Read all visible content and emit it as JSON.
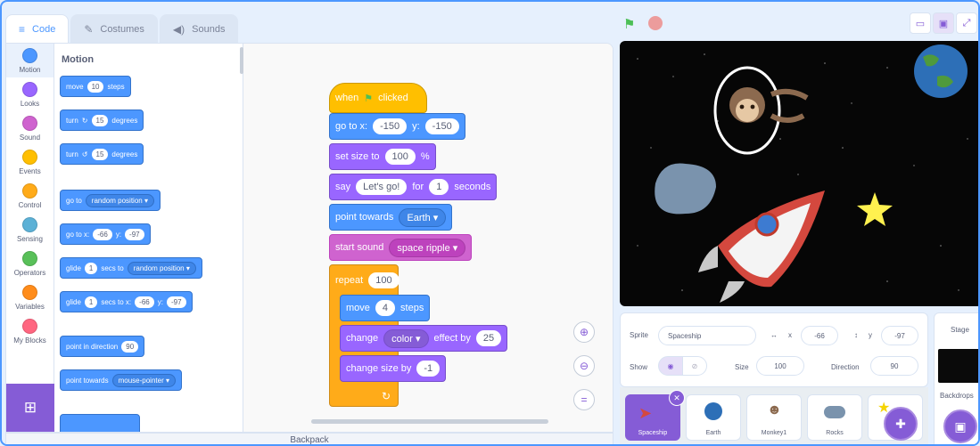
{
  "tabs": {
    "code": "Code",
    "costumes": "Costumes",
    "sounds": "Sounds"
  },
  "categories": [
    {
      "label": "Motion",
      "color": "#4c97ff"
    },
    {
      "label": "Looks",
      "color": "#9966ff"
    },
    {
      "label": "Sound",
      "color": "#cf63cf"
    },
    {
      "label": "Events",
      "color": "#ffbf00"
    },
    {
      "label": "Control",
      "color": "#ffab19"
    },
    {
      "label": "Sensing",
      "color": "#5cb1d6"
    },
    {
      "label": "Operators",
      "color": "#59c059"
    },
    {
      "label": "Variables",
      "color": "#ff8c1a"
    },
    {
      "label": "My Blocks",
      "color": "#ff6680"
    }
  ],
  "palette": {
    "title": "Motion",
    "move": {
      "a": "move",
      "v": "10",
      "b": "steps"
    },
    "turn_right": {
      "a": "turn",
      "v": "15",
      "b": "degrees"
    },
    "turn_left": {
      "a": "turn",
      "v": "15",
      "b": "degrees"
    },
    "goto": {
      "a": "go to",
      "dd": "random position"
    },
    "gotoxy": {
      "a": "go to x:",
      "x": "-66",
      "yl": "y:",
      "y": "-97"
    },
    "glide": {
      "a": "glide",
      "v": "1",
      "b": "secs to",
      "dd": "random position"
    },
    "glidexy": {
      "a": "glide",
      "v": "1",
      "b": "secs to x:",
      "x": "-66",
      "yl": "y:",
      "y": "-97"
    },
    "point_dir": {
      "a": "point in direction",
      "v": "90"
    },
    "point_towards": {
      "a": "point towards",
      "dd": "mouse-pointer"
    }
  },
  "script": {
    "when_flag": {
      "a": "when",
      "b": "clicked"
    },
    "goto": {
      "a": "go to x:",
      "x": "-150",
      "yl": "y:",
      "y": "-150"
    },
    "size": {
      "a": "set size to",
      "v": "100",
      "b": "%"
    },
    "say": {
      "a": "say",
      "msg": "Let's go!",
      "b": "for",
      "v": "1",
      "c": "seconds"
    },
    "point": {
      "a": "point towards",
      "dd": "Earth"
    },
    "sound": {
      "a": "start sound",
      "dd": "space ripple"
    },
    "repeat": {
      "a": "repeat",
      "v": "100"
    },
    "move": {
      "a": "move",
      "v": "4",
      "b": "steps"
    },
    "effect": {
      "a": "change",
      "dd": "color",
      "b": "effect by",
      "v": "25"
    },
    "chsize": {
      "a": "change size by",
      "v": "-1"
    }
  },
  "backpack": "Backpack",
  "sprite_info": {
    "sprite_label": "Sprite",
    "sprite_name": "Spaceship",
    "x_label": "x",
    "x_value": "-66",
    "y_label": "y",
    "y_value": "-97",
    "show_label": "Show",
    "size_label": "Size",
    "size_value": "100",
    "direction_label": "Direction",
    "direction_value": "90"
  },
  "sprites": [
    "Spaceship",
    "Earth",
    "Monkey1",
    "Rocks",
    ""
  ],
  "stage_panel": {
    "title": "Stage",
    "backdrops": "Backdrops"
  }
}
